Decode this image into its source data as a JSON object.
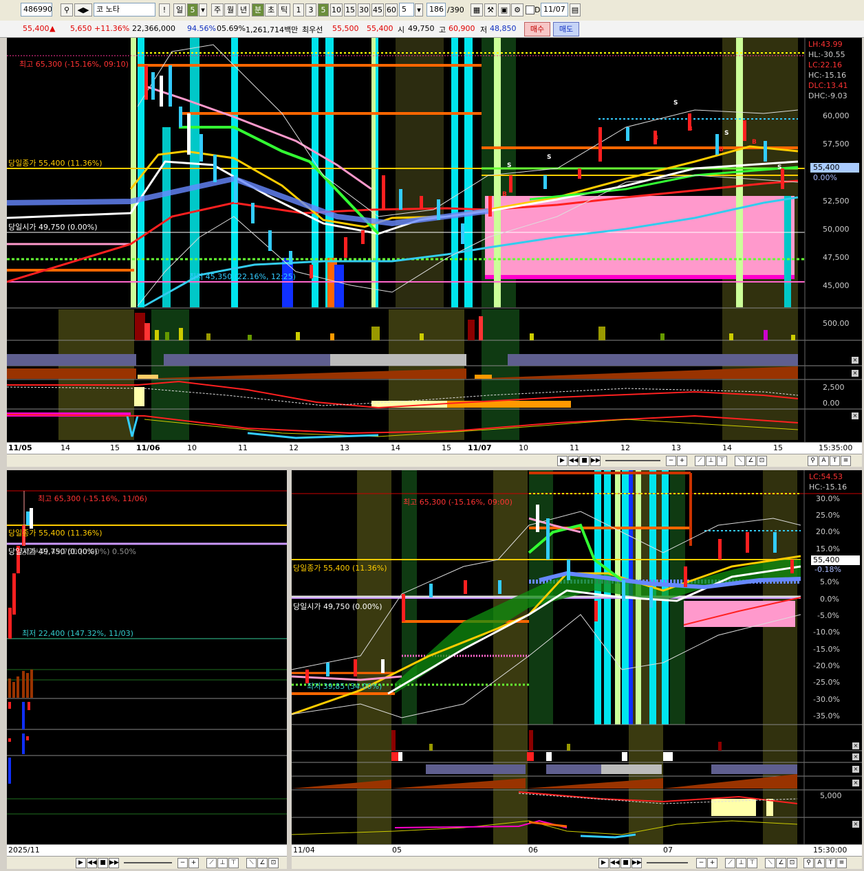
{
  "toolbar": {
    "code": "486990",
    "name": "코 노타",
    "excl": "!",
    "periods": [
      "일",
      "주",
      "월",
      "년",
      "분",
      "초",
      "틱"
    ],
    "period_interval": "5",
    "active_period": "분",
    "intervals": [
      "1",
      "3",
      "5",
      "10",
      "15",
      "30",
      "45",
      "60"
    ],
    "interval_sel": "5",
    "count": "186",
    "total": "/390",
    "date_check": "D",
    "date": "11/07"
  },
  "quote": {
    "price": "55,400",
    "arrow": "▲",
    "change": "5,650",
    "change_pct": "+11.36%",
    "volume": "22,366,000",
    "ratio1": "94.56%",
    "ratio2": "05.69%",
    "amount": "1,261,714백만",
    "best_ask_label": "최우선",
    "best_ask": "55,500",
    "best_bid": "55,400",
    "open_label": "시",
    "open": "49,750",
    "high_label": "고",
    "high": "60,900",
    "low_label": "저",
    "low": "48,850",
    "buy_label": "매수",
    "sell_label": "매도"
  },
  "top_chart": {
    "ind_labels": [
      {
        "text": "LH:43.99",
        "color": "#ff3333"
      },
      {
        "text": "HL:-30.55",
        "color": "#cccccc"
      },
      {
        "text": "LC:22.16",
        "color": "#ff3333"
      },
      {
        "text": "HC:-15.16",
        "color": "#cccccc"
      },
      {
        "text": "DLC:13.41",
        "color": "#ff3333"
      },
      {
        "text": "DHC:-9.03",
        "color": "#cccccc"
      }
    ],
    "price_scale": [
      "60,000",
      "57,500",
      "55,400",
      "0.00%",
      "52,500",
      "50,000",
      "47,500",
      "45,000"
    ],
    "vol_scale": "500.00",
    "osc_scale": [
      "2,500",
      "0.00"
    ],
    "high_note": "최고 65,300 (-15.16%, 09:10)",
    "close_note": "당일종가 55,400 (11.36%)",
    "open_note": "당일시가 49,750 (0.00%)",
    "low_note": "최저 45,350 (22.16%, 12:25)",
    "dates": [
      "11/05",
      "14",
      "15",
      "11/06",
      "10",
      "11",
      "12",
      "13",
      "14",
      "15",
      "11/07",
      "10",
      "11",
      "12",
      "13",
      "14",
      "15"
    ],
    "time": "15:35:00"
  },
  "daily_chart": {
    "high_note": "최고 65,300 (-15.16%, 11/06)",
    "close_note": "당일종가 55,400 (11.36%)",
    "open_note": "당일시가 49,750 (0.00%)",
    "open_note2": "당일시가 49,750 (0.00%) 0.50%",
    "low_note": "최저 22,400 (147.32%, 11/03)",
    "date": "2025/11"
  },
  "bottom_chart": {
    "ind_labels": [
      {
        "text": "LC:54.53",
        "color": "#ff3333"
      },
      {
        "text": "HC:-15.16",
        "color": "#cccccc"
      }
    ],
    "pct_scale": [
      "30.0%",
      "25.0%",
      "20.0%",
      "15.0%",
      "55,400",
      "-0.18%",
      "5.0%",
      "0.0%",
      "-5.0%",
      "-10.0%",
      "-15.0%",
      "-20.0%",
      "-25.0%",
      "-30.0%",
      "-35.0%"
    ],
    "high_note": "최고 65,300 (-15.16%, 09:00)",
    "close_note": "당일종가 55,400 (11.36%)",
    "open_note": "당일시가 49,750 (0.00%)",
    "low_note": "최저 39,85 (34.00%)",
    "osc_scale": "5,000",
    "dates": [
      "11/04",
      "05",
      "06",
      "07"
    ],
    "time": "15:30:00"
  }
}
